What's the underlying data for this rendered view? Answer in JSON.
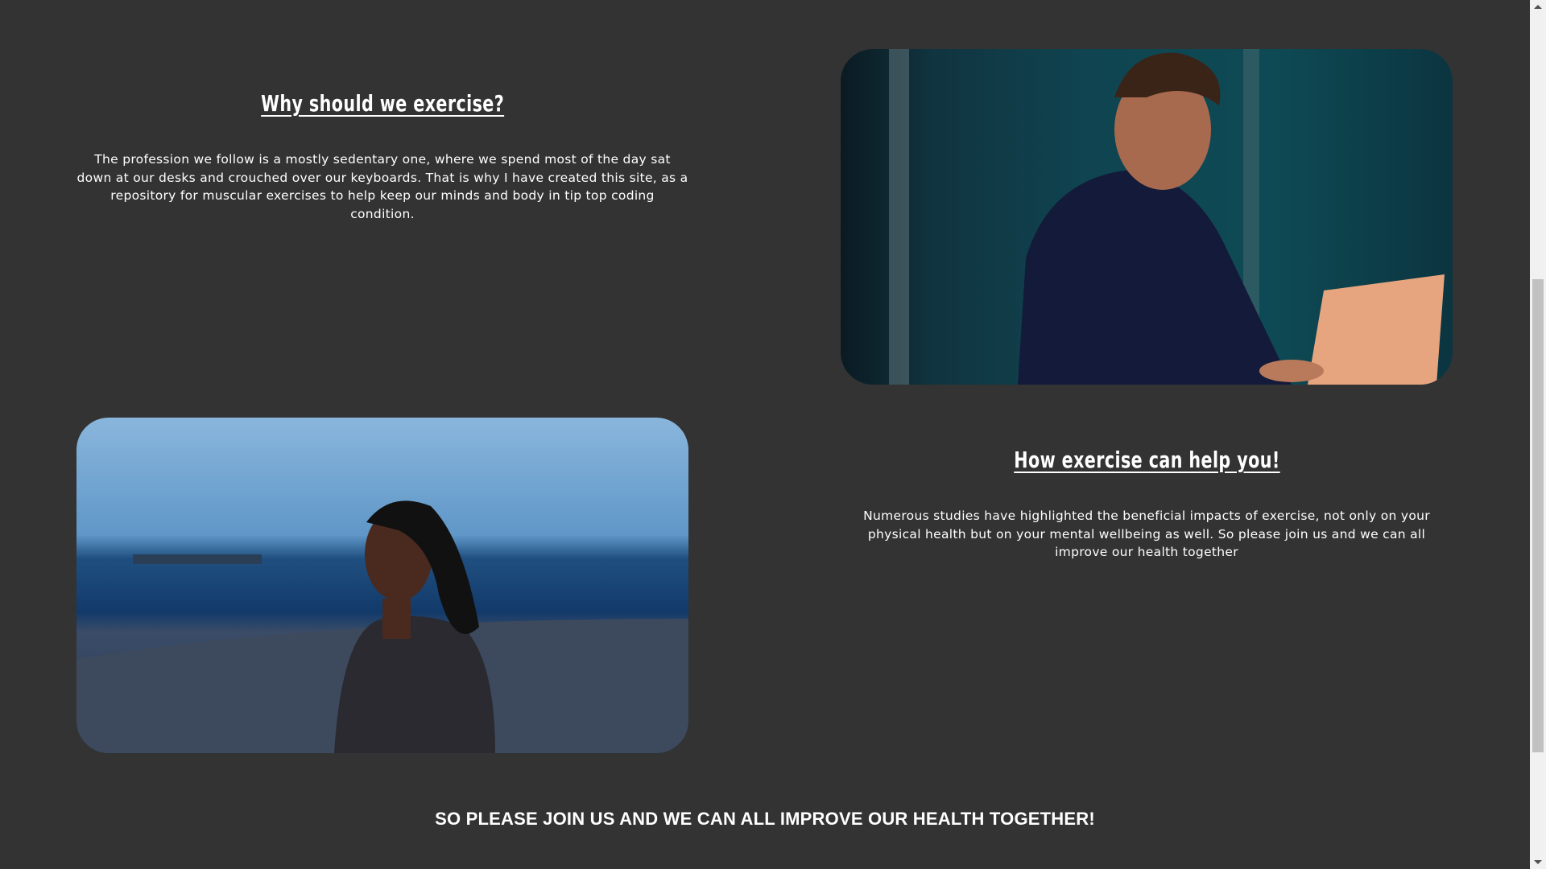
{
  "section1": {
    "heading": "Why should we exercise?",
    "text": "The profession we follow is a mostly sedentary one, where we spend most of the day sat down at our desks and crouched over our keyboards. That is why I have created this site, as a repository for muscular exercises to help keep our minds and body in tip top coding condition."
  },
  "section2": {
    "heading": "How exercise can help you!",
    "text": "Numerous studies have highlighted the beneficial impacts of exercise, not only on your physical health but on your mental wellbeing as well. So please join us and we can all improve our health together"
  },
  "banner": "SO PLEASE JOIN US AND WE CAN ALL IMPROVE OUR HEALTH TOGETHER!"
}
